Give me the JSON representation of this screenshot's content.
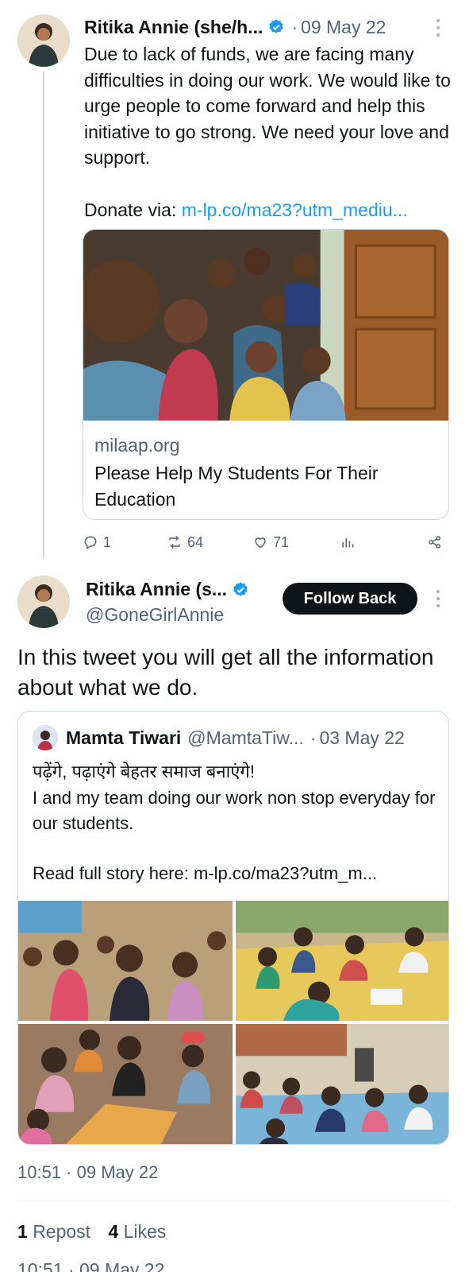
{
  "tweet1": {
    "author_name": "Ritika Annie (she/h...",
    "date": "09 May 22",
    "text": "Due to lack of funds, we are facing many difficulties in doing our work. We would like to urge people to come forward and help this initiative to go strong. We need your love and support.",
    "donate_prefix": "Donate via:",
    "donate_link": "m-lp.co/ma23?utm_mediu...",
    "card": {
      "domain": "milaap.org",
      "title": "Please Help My Students For Their Education"
    },
    "actions": {
      "replies": "1",
      "reposts": "64",
      "likes": "71"
    }
  },
  "tweet2": {
    "author_name": "Ritika Annie (s...",
    "handle": "@GoneGirlAnnie",
    "follow_label": "Follow Back",
    "text": "In this tweet you will get all the information about what we do.",
    "quote": {
      "name": "Mamta Tiwari",
      "handle": "@MamtaTiw...",
      "date": "03 May 22",
      "line1": "पढ़ेंगे, पढ़ाएंगे बेहतर समाज बनाएंगे!",
      "line2": "I and my team doing our work non stop everyday for our students.",
      "readmore_prefix": "Read full story here:",
      "readmore_link": "m-lp.co/ma23?utm_m..."
    },
    "timestamp": "10:51 · 09 May 22",
    "reposts_count": "1",
    "reposts_label": "Repost",
    "likes_count": "4",
    "likes_label": "Likes",
    "cutoff_text": "10:51 · 09 May 22"
  },
  "colors": {
    "accent": "#1d9bf0",
    "text": "#0f1419",
    "muted": "#536471",
    "border": "#cfd9de"
  },
  "icons": [
    "verified-badge-icon",
    "more-vertical-icon",
    "reply-icon",
    "repost-icon",
    "like-icon",
    "views-icon",
    "share-icon"
  ]
}
